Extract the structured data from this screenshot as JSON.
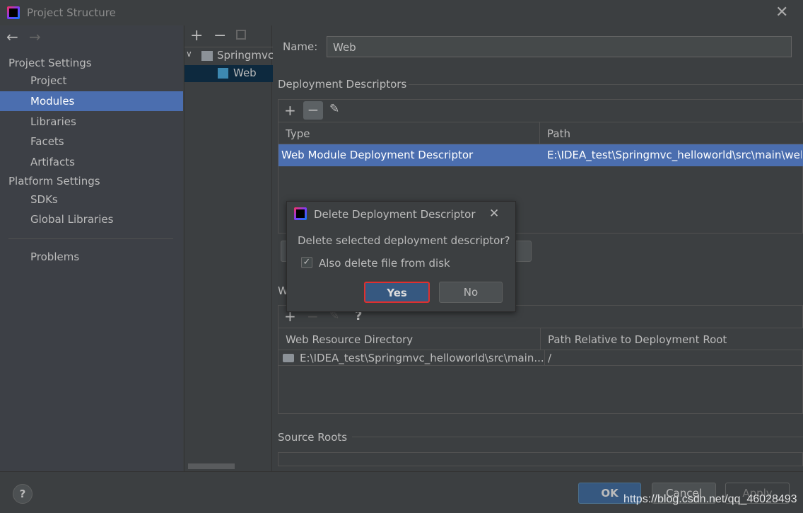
{
  "window": {
    "title": "Project Structure"
  },
  "sidebar": {
    "project_settings": "Project Settings",
    "items": [
      {
        "label": "Project"
      },
      {
        "label": "Modules"
      },
      {
        "label": "Libraries"
      },
      {
        "label": "Facets"
      },
      {
        "label": "Artifacts"
      }
    ],
    "platform_settings": "Platform Settings",
    "platform_items": [
      {
        "label": "SDKs"
      },
      {
        "label": "Global Libraries"
      }
    ],
    "problems": "Problems"
  },
  "tree": {
    "root": "Springmvc_",
    "child": "Web"
  },
  "main": {
    "name_label": "Name:",
    "name_value": "Web",
    "deployment_descriptors": "Deployment Descriptors",
    "dd_columns": [
      "Type",
      "Path"
    ],
    "dd_row": [
      "Web Module Deployment Descriptor",
      "E:\\IDEA_test\\Springmvc_helloworld\\src\\main\\web"
    ],
    "web_resource_label": "W",
    "wr_columns": [
      "Web Resource Directory",
      "Path Relative to Deployment Root"
    ],
    "wr_row": [
      "E:\\IDEA_test\\Springmvc_helloworld\\src\\main...",
      "/"
    ],
    "help_glyph": "?",
    "source_roots": "Source Roots"
  },
  "dialog": {
    "title": "Delete Deployment Descriptor",
    "message": "Delete selected deployment descriptor?",
    "checkbox_label": "Also delete file from disk",
    "checked": true,
    "yes": "Yes",
    "no": "No"
  },
  "footer": {
    "ok": "OK",
    "cancel": "Cancel",
    "apply": "Apply",
    "help": "?"
  },
  "watermark": "https://blog.csdn.net/qq_46028493"
}
